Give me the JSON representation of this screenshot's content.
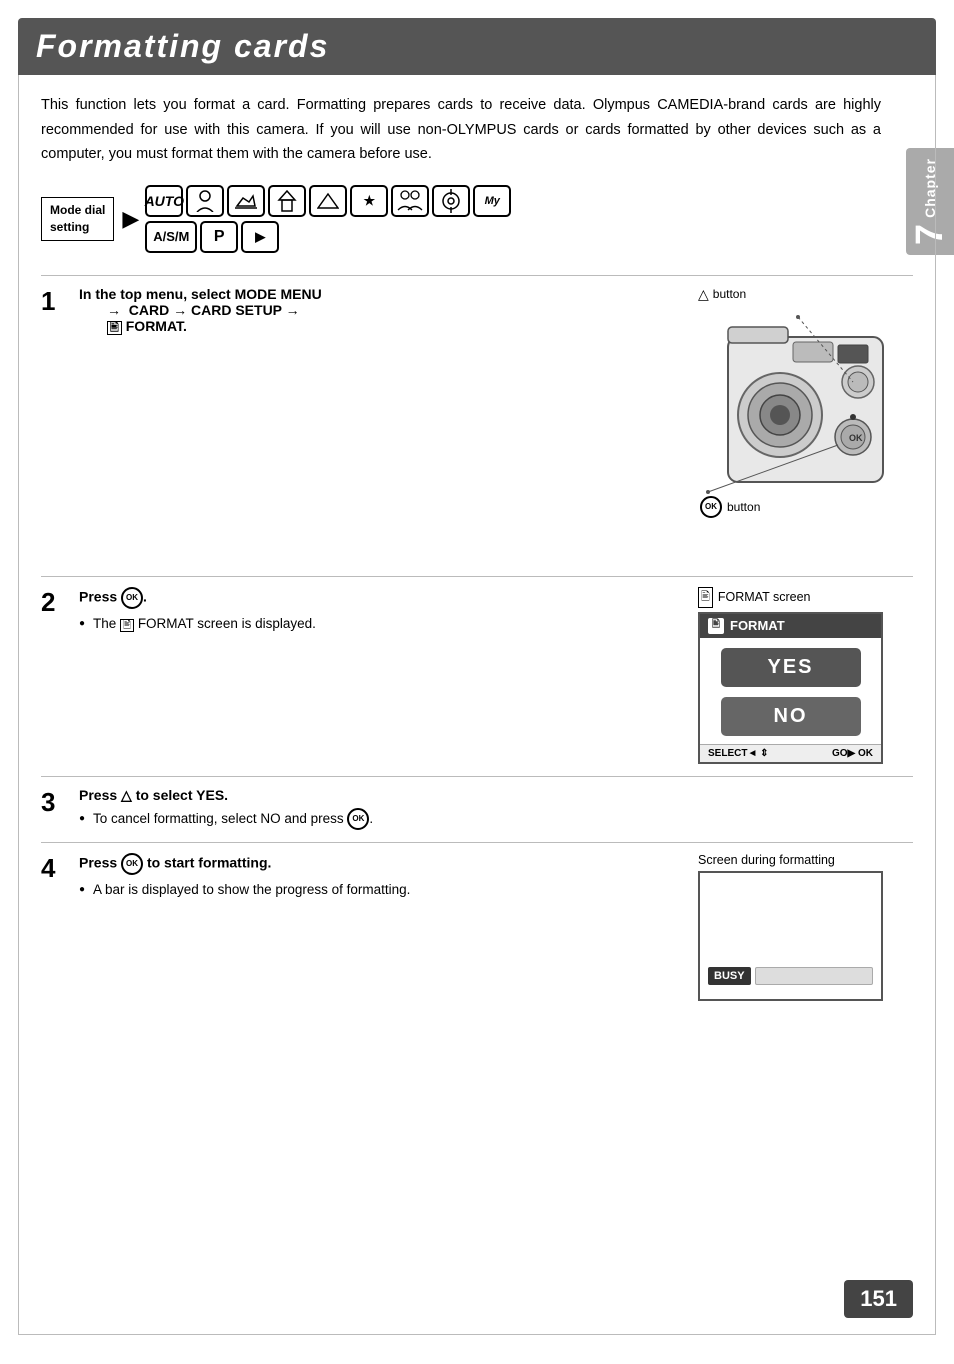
{
  "header": {
    "title": "Formatting cards",
    "bg": "#555"
  },
  "chapter": {
    "label": "Chapter",
    "number": "7"
  },
  "intro": "This function lets you format a card. Formatting prepares cards to receive data. Olympus CAMEDIA-brand cards are highly recommended for use with this camera. If you will use non-OLYMPUS cards or cards formatted by other devices such as a computer, you must format them with the camera before use.",
  "mode_dial": {
    "label": "Mode dial\nsetting",
    "icons_row1": [
      "AUTO",
      "👤",
      "🔧",
      "🏠",
      "▲",
      "★",
      "👫",
      "♾",
      "My"
    ],
    "icons_row2": [
      "A/S/M",
      "P",
      "▶"
    ]
  },
  "steps": [
    {
      "number": "1",
      "title": "In the top menu, select MODE MENU → CARD → CARD SETUP → 🖹 FORMAT.",
      "bullets": [],
      "has_camera_diagram": true
    },
    {
      "number": "2",
      "title": "Press ⊙.",
      "bullets": [
        "The 🖹 FORMAT screen is displayed."
      ],
      "has_format_screen": true
    },
    {
      "number": "3",
      "title": "Press △ to select YES.",
      "bullets": [
        "To cancel formatting, select NO and press ⊙."
      ],
      "has_format_screen": false
    },
    {
      "number": "4",
      "title": "Press ⊙ to start formatting.",
      "bullets": [
        "A bar is displayed to show the progress of formatting."
      ],
      "has_busy_screen": true
    }
  ],
  "format_screen": {
    "title": "FORMAT",
    "yes_label": "YES",
    "no_label": "NO",
    "footer_left": "SELECT◄ ⇕",
    "footer_right": "GO▶ OK"
  },
  "busy_screen": {
    "label": "BUSY"
  },
  "labels": {
    "triangle_button": "△  button",
    "ok_button": "button",
    "format_screen_caption": "🖹 FORMAT screen",
    "screen_during_formatting": "Screen during formatting"
  },
  "page_number": "151"
}
